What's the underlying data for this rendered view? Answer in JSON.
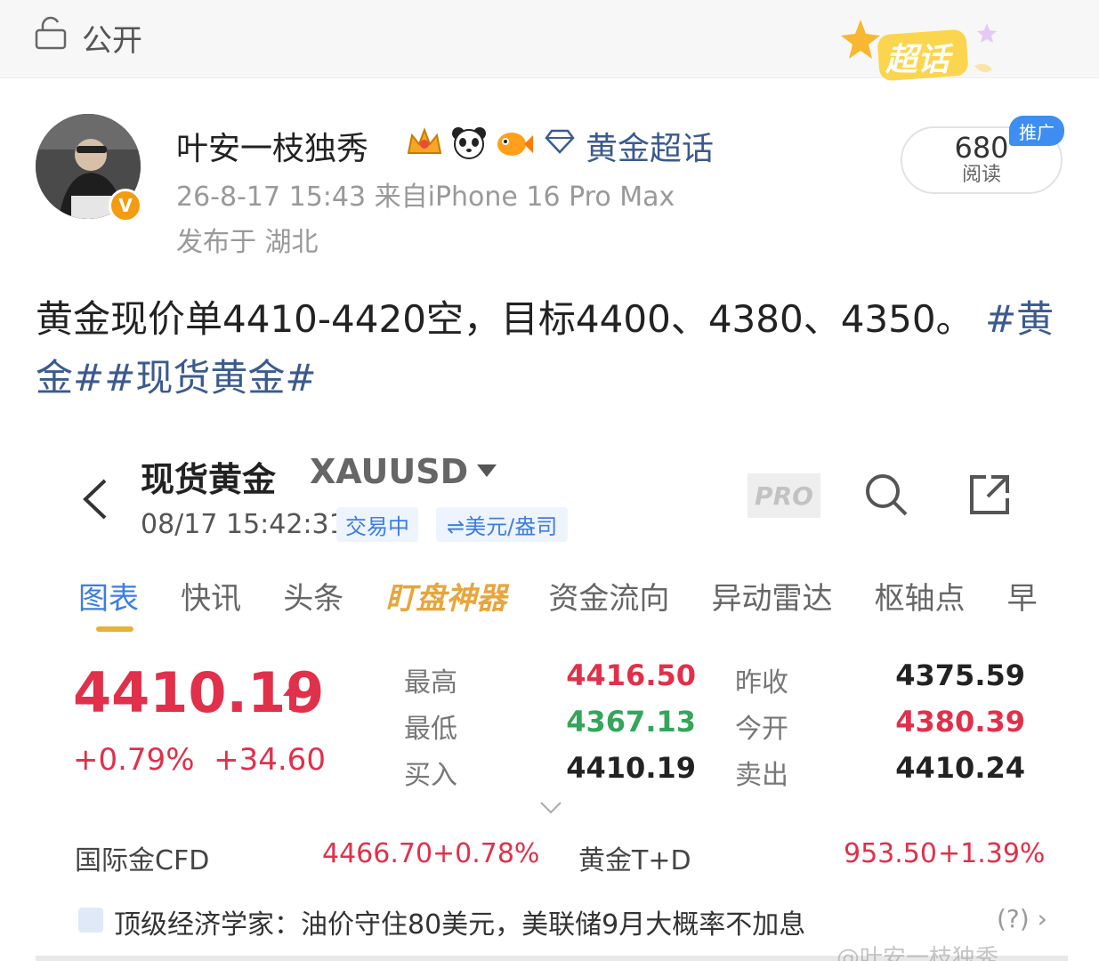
{
  "header": {
    "visibility_label": "公开",
    "badge_label": "超话"
  },
  "post": {
    "author": "叶安一枝独秀",
    "supertopic": "黄金超话",
    "meta": "26-8-17 15:43  来自iPhone 16 Pro Max",
    "location": "发布于 湖北",
    "reads_count": "680",
    "reads_label": "阅读",
    "promo_tag": "推广",
    "text_main": "黄金现价单4410-4420空，目标4400、4380、4350。 ",
    "hashtags": "#黄金##现货黄金#",
    "watermark": "@叶安一枝独秀"
  },
  "app": {
    "instrument_name": "现货黄金",
    "instrument_code": "XAUUSD",
    "quote_time": "08/17 15:42:31",
    "status_tag": "交易中",
    "unit_tag": "⇌美元/盎司",
    "pro_label": "PRO",
    "tabs": [
      "图表",
      "快讯",
      "头条",
      "盯盘神器",
      "资金流向",
      "异动雷达",
      "枢轴点",
      "早"
    ],
    "price": "4410.19",
    "change_pct": "+0.79%",
    "change_abs": "+34.60",
    "stats": {
      "high_label": "最高",
      "high": "4416.50",
      "low_label": "最低",
      "low": "4367.13",
      "bid_label": "买入",
      "bid": "4410.19",
      "prev_close_label": "昨收",
      "prev_close": "4375.59",
      "open_label": "今开",
      "open": "4380.39",
      "ask_label": "卖出",
      "ask": "4410.24"
    },
    "related": {
      "cfd_label": "国际金CFD",
      "cfd_price": "4466.70",
      "cfd_change": "+0.78%",
      "td_label": "黄金T+D",
      "td_price": "953.50",
      "td_change": "+1.39%"
    },
    "news": "顶级经济学家：油价守住80美元，美联储9月大概率不加息",
    "news_more": "(?) ›"
  },
  "colors": {
    "up": "#e1304a",
    "down": "#35a55b",
    "link": "#3b5a8f",
    "accent": "#3d7ee0"
  }
}
